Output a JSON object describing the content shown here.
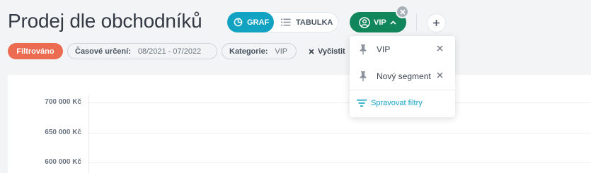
{
  "page": {
    "title": "Prodej dle obchodníků"
  },
  "view_toggle": {
    "graph_label": "GRAF",
    "table_label": "TABULKA"
  },
  "segment_button": {
    "label": "VIP"
  },
  "filters": {
    "filtered_label": "Filtrováno",
    "time": {
      "key": "Časové určení:",
      "value": "08/2021 - 07/2022"
    },
    "category": {
      "key": "Kategorie:",
      "value": "VIP"
    },
    "clear_label": "Vyčistit"
  },
  "dropdown": {
    "items": [
      {
        "label": "VIP"
      },
      {
        "label": "Nový segment"
      }
    ],
    "manage_label": "Spravovat filtry"
  },
  "chart": {
    "y_ticks": [
      "700 000 Kč",
      "650 000 Kč",
      "600 000 Kč"
    ]
  },
  "colors": {
    "accent": "#12a3c3",
    "segment_green": "#11865b",
    "filtered_badge": "#ec6c52"
  }
}
